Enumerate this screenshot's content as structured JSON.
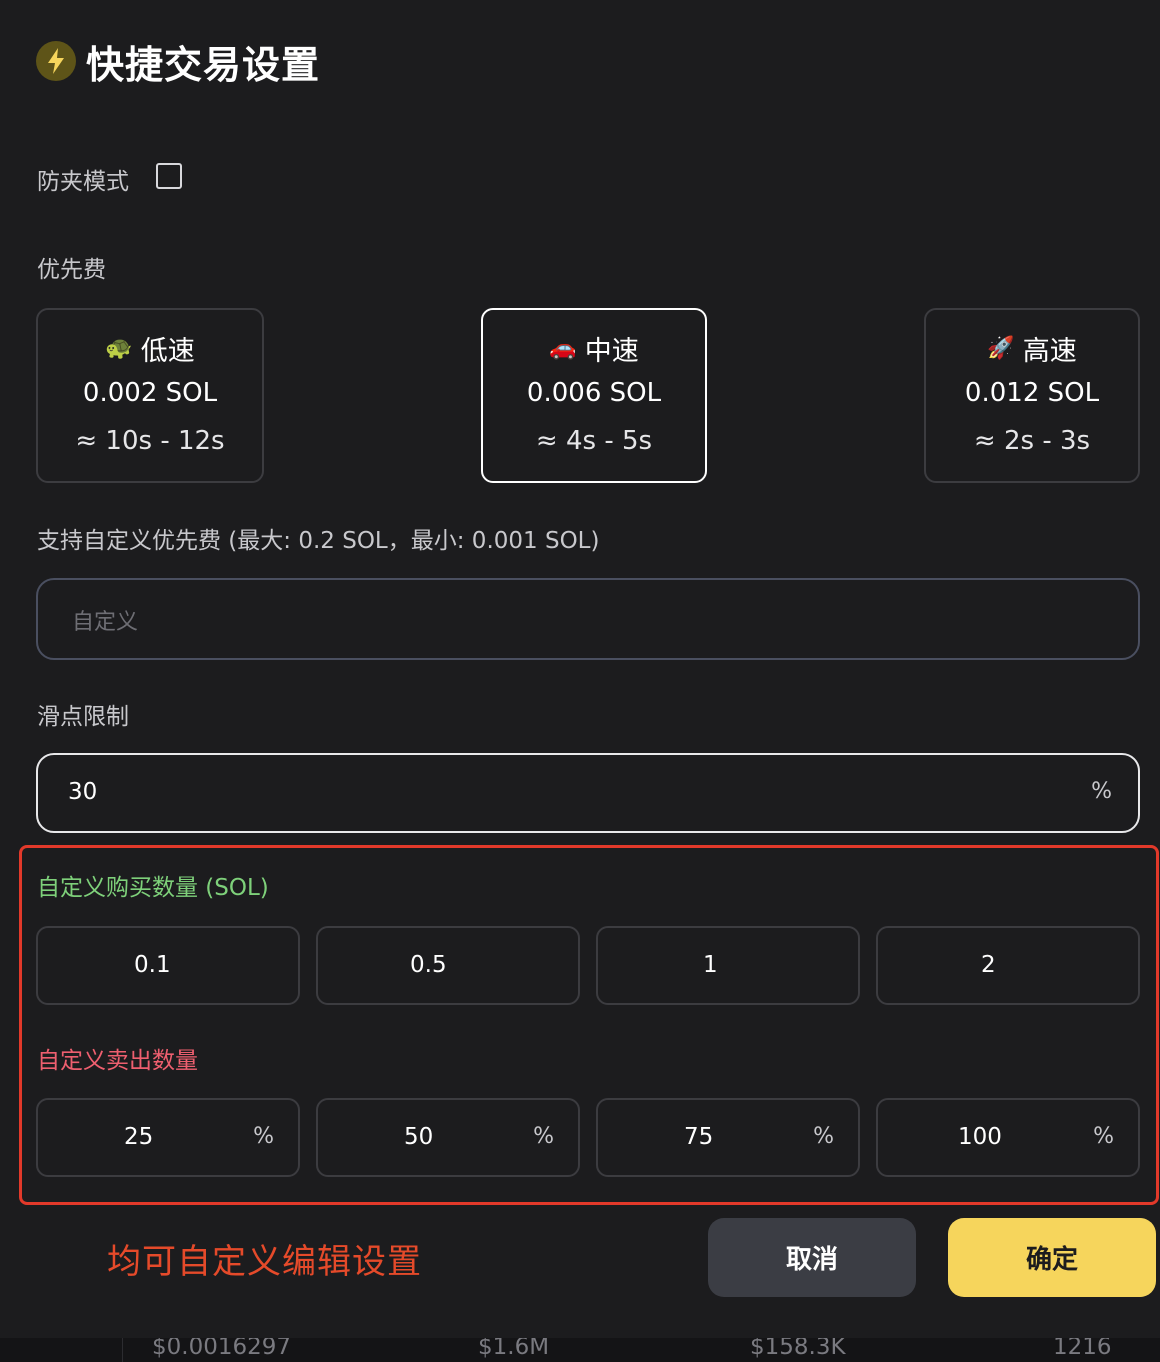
{
  "header": {
    "title": "快捷交易设置",
    "icon": "lightning-bolt-icon",
    "icon_color": "#f6d55c"
  },
  "anti_mev": {
    "label": "防夹模式",
    "checked": false
  },
  "priority_fee": {
    "label": "优先费",
    "options": [
      {
        "emoji": "🐢",
        "name": "低速",
        "fee": "0.002 SOL",
        "time": "≈ 10s - 12s",
        "selected": false
      },
      {
        "emoji": "🚗",
        "name": "中速",
        "fee": "0.006 SOL",
        "time": "≈ 4s - 5s",
        "selected": true
      },
      {
        "emoji": "🚀",
        "name": "高速",
        "fee": "0.012 SOL",
        "time": "≈ 2s - 3s",
        "selected": false
      }
    ],
    "custom_hint": "支持自定义优先费 (最大: 0.2 SOL，最小: 0.001 SOL)",
    "custom_placeholder": "自定义"
  },
  "slippage": {
    "label": "滑点限制",
    "value": "30",
    "unit": "%"
  },
  "buy_amounts": {
    "label": "自定义购买数量 (SOL)",
    "values": [
      "0.1",
      "0.5",
      "1",
      "2"
    ]
  },
  "sell_amounts": {
    "label": "自定义卖出数量",
    "values": [
      "25",
      "50",
      "75",
      "100"
    ],
    "unit": "%"
  },
  "annotation": "均可自定义编辑设置",
  "buttons": {
    "cancel": "取消",
    "confirm": "确定"
  },
  "background_row": [
    "$0.0016297",
    "$1.6M",
    "$158.3K",
    "1216"
  ],
  "colors": {
    "background": "#1c1c1e",
    "accent_yellow": "#f6d55c",
    "annotation_red": "#e2392a",
    "buy_green": "#7ed07a",
    "sell_pink": "#ee5f6f"
  }
}
